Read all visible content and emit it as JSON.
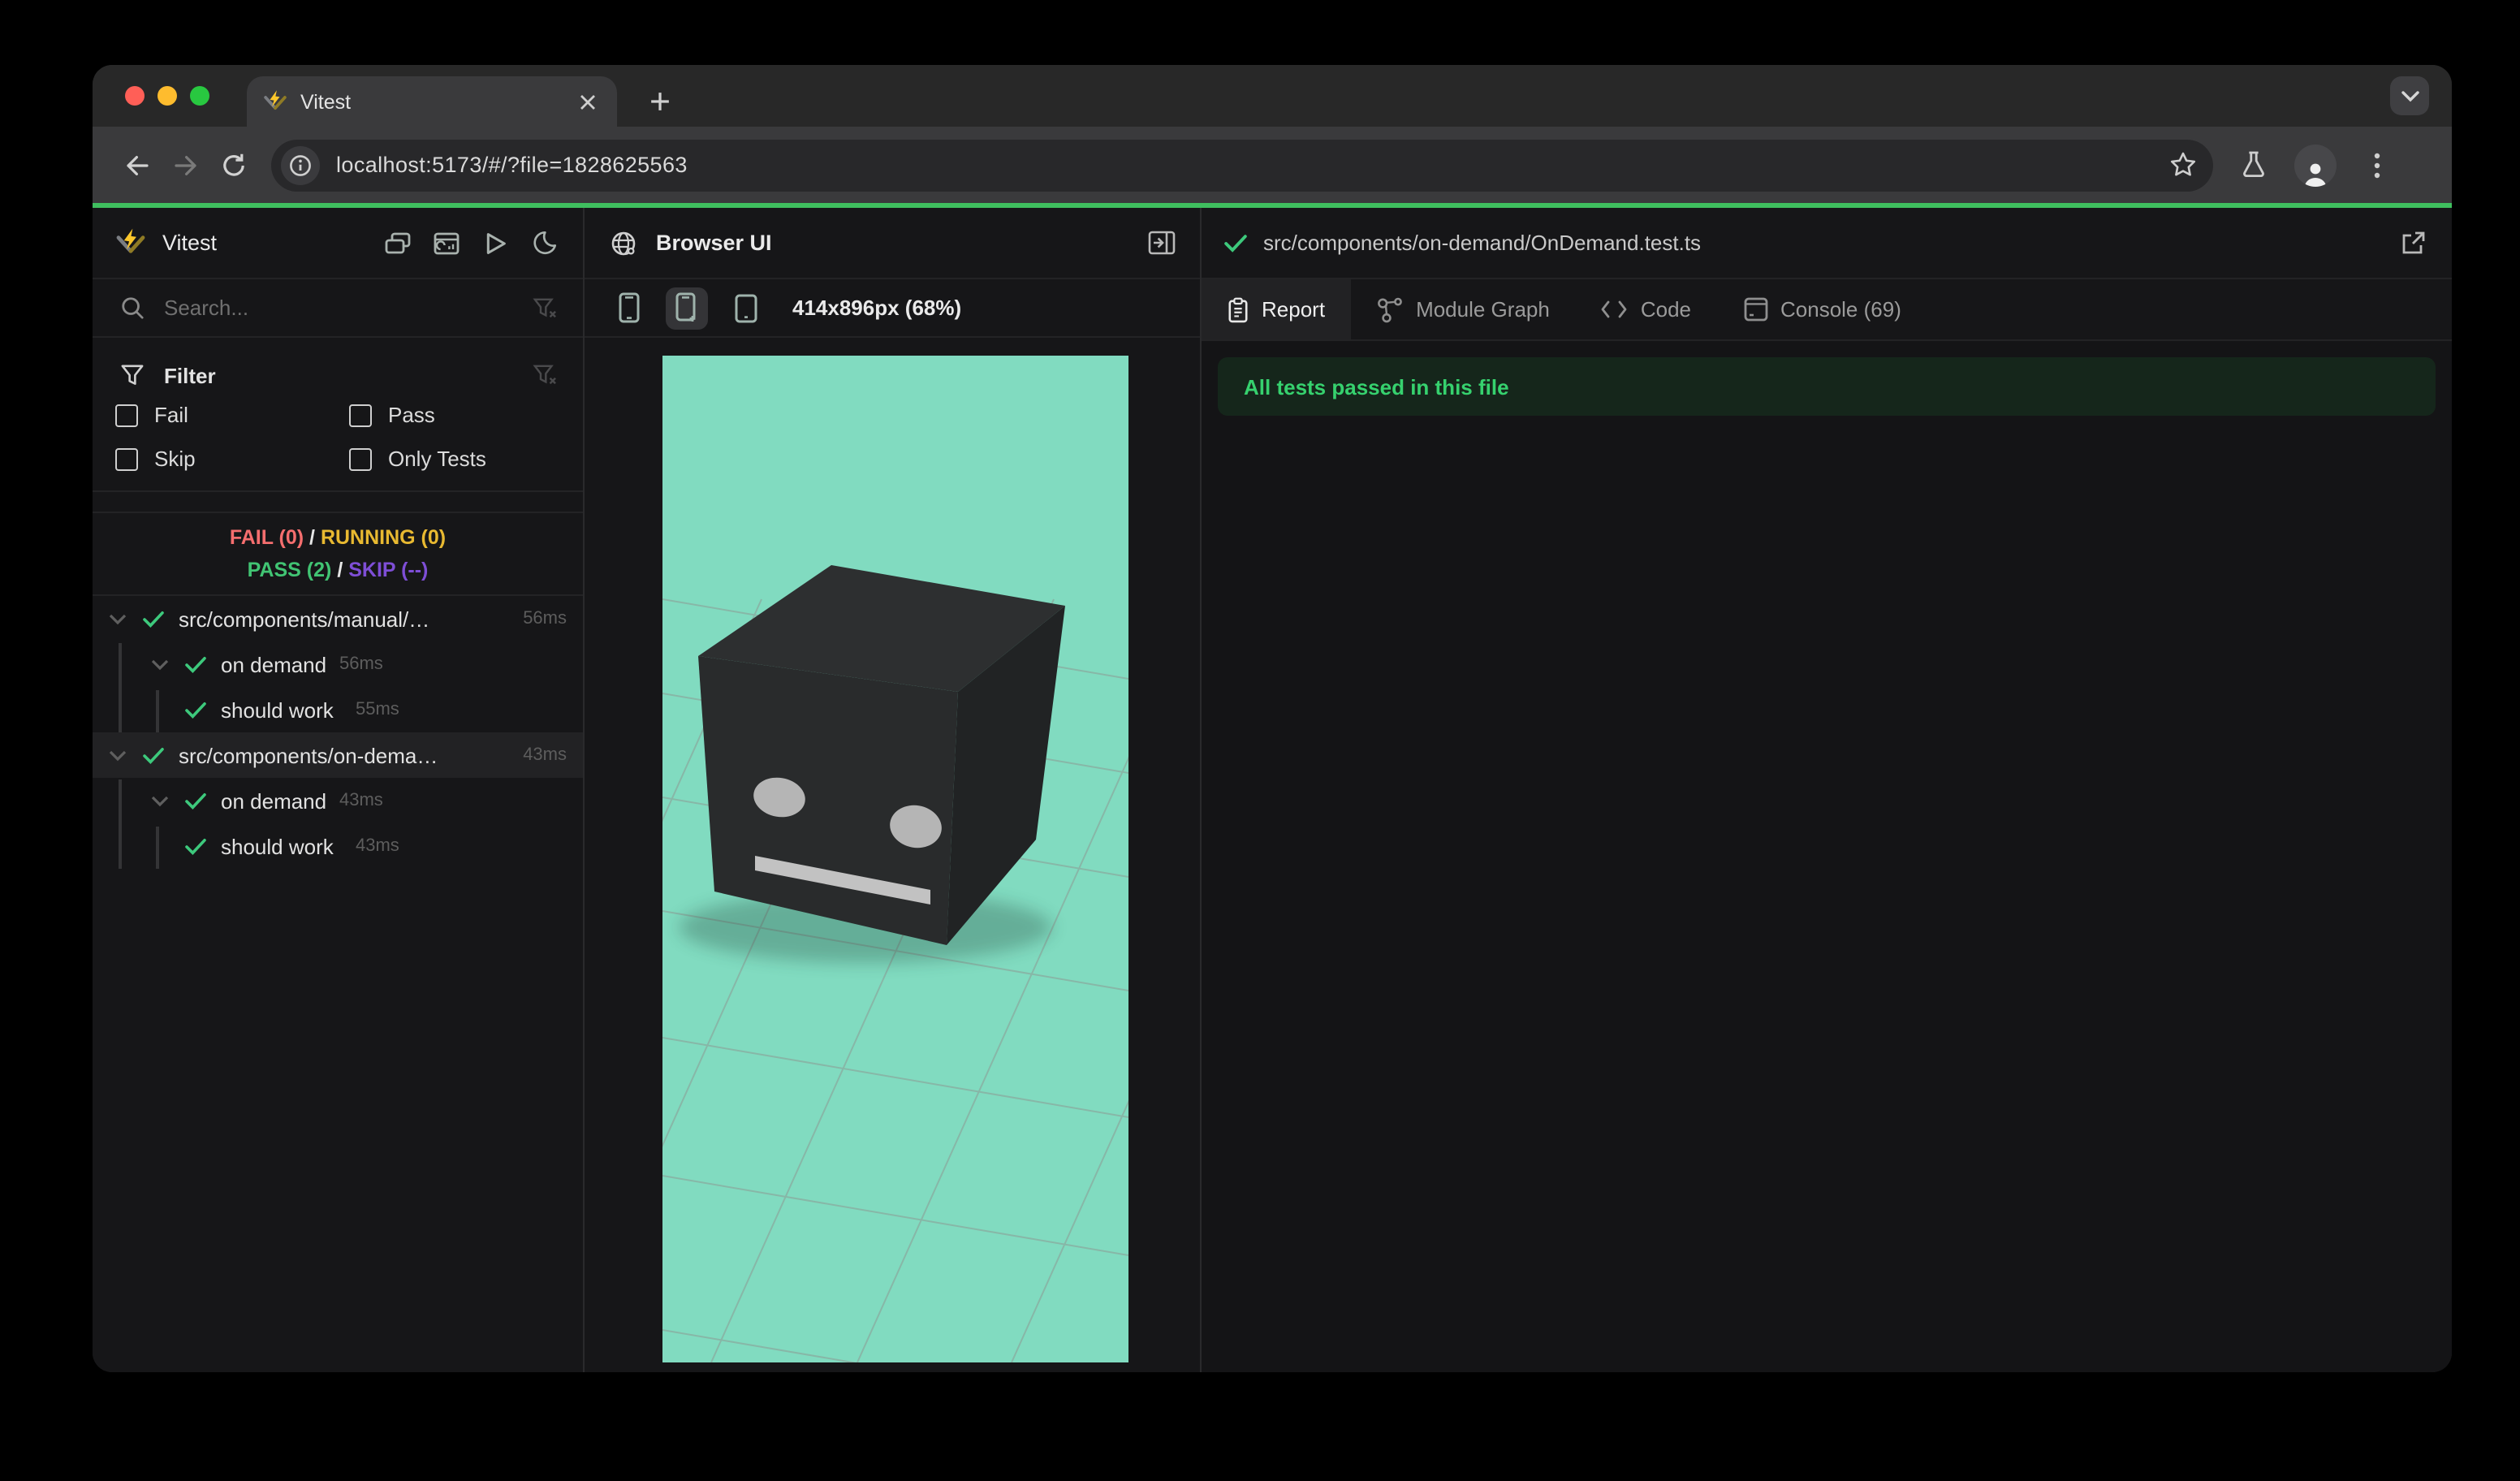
{
  "colors": {
    "progress_green": "#3fbf5f",
    "teal": "#81dbc0",
    "pass_green": "#41c473",
    "fail_red": "#f56e6e",
    "running_yellow": "#e8b931",
    "skip_purple": "#7e4ed6",
    "check_green": "#3dc97c",
    "banner_bg": "#15261b",
    "banner_text": "#36d16e",
    "vitest_yellow": "#fcc72b"
  },
  "browser": {
    "tab_title": "Vitest",
    "url": "localhost:5173/#/?file=1828625563"
  },
  "sidebar": {
    "app_title": "Vitest",
    "search_placeholder": "Search...",
    "filter": {
      "title": "Filter",
      "options": [
        "Fail",
        "Pass",
        "Skip",
        "Only Tests"
      ]
    },
    "stats": {
      "fail": "FAIL (0)",
      "running": "RUNNING (0)",
      "pass": "PASS (2)",
      "skip": "SKIP (--)",
      "sep": "/"
    },
    "tree": [
      {
        "label": "src/components/manual/…",
        "time": "56ms"
      },
      {
        "label": "on demand",
        "time": "56ms"
      },
      {
        "label": "should work",
        "time": "55ms"
      },
      {
        "label": "src/components/on-dema…",
        "time": "43ms"
      },
      {
        "label": "on demand",
        "time": "43ms"
      },
      {
        "label": "should work",
        "time": "43ms"
      }
    ]
  },
  "preview": {
    "title": "Browser UI",
    "viewport": "414x896px (68%)"
  },
  "report": {
    "file_path": "src/components/on-demand/OnDemand.test.ts",
    "tabs": [
      "Report",
      "Module Graph",
      "Code",
      "Console (69)"
    ],
    "banner": "All tests passed in this file"
  }
}
